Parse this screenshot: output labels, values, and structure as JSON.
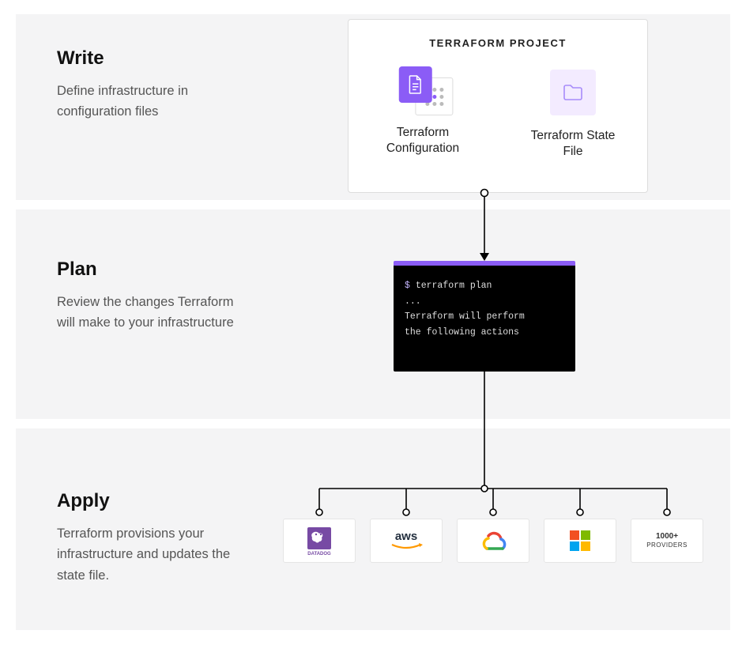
{
  "sections": {
    "write": {
      "title": "Write",
      "desc": "Define infrastructure in configuration files"
    },
    "plan": {
      "title": "Plan",
      "desc": "Review the changes Terraform will make to your infrastructure"
    },
    "apply": {
      "title": "Apply",
      "desc": "Terraform provisions your infrastructure and updates the state file."
    }
  },
  "project": {
    "title": "TERRAFORM PROJECT",
    "config_label": "Terraform Configuration",
    "state_label": "Terraform State File"
  },
  "terminal": {
    "prompt": "$ ",
    "command": "terraform plan",
    "ellipsis": "...",
    "line1": "Terraform will perform",
    "line2": "the following actions"
  },
  "providers": {
    "datadog": "DATADOG",
    "aws": "aws",
    "gcp": "Google Cloud",
    "azure": "Microsoft",
    "more_line1": "1000+",
    "more_line2": "PROVIDERS"
  }
}
